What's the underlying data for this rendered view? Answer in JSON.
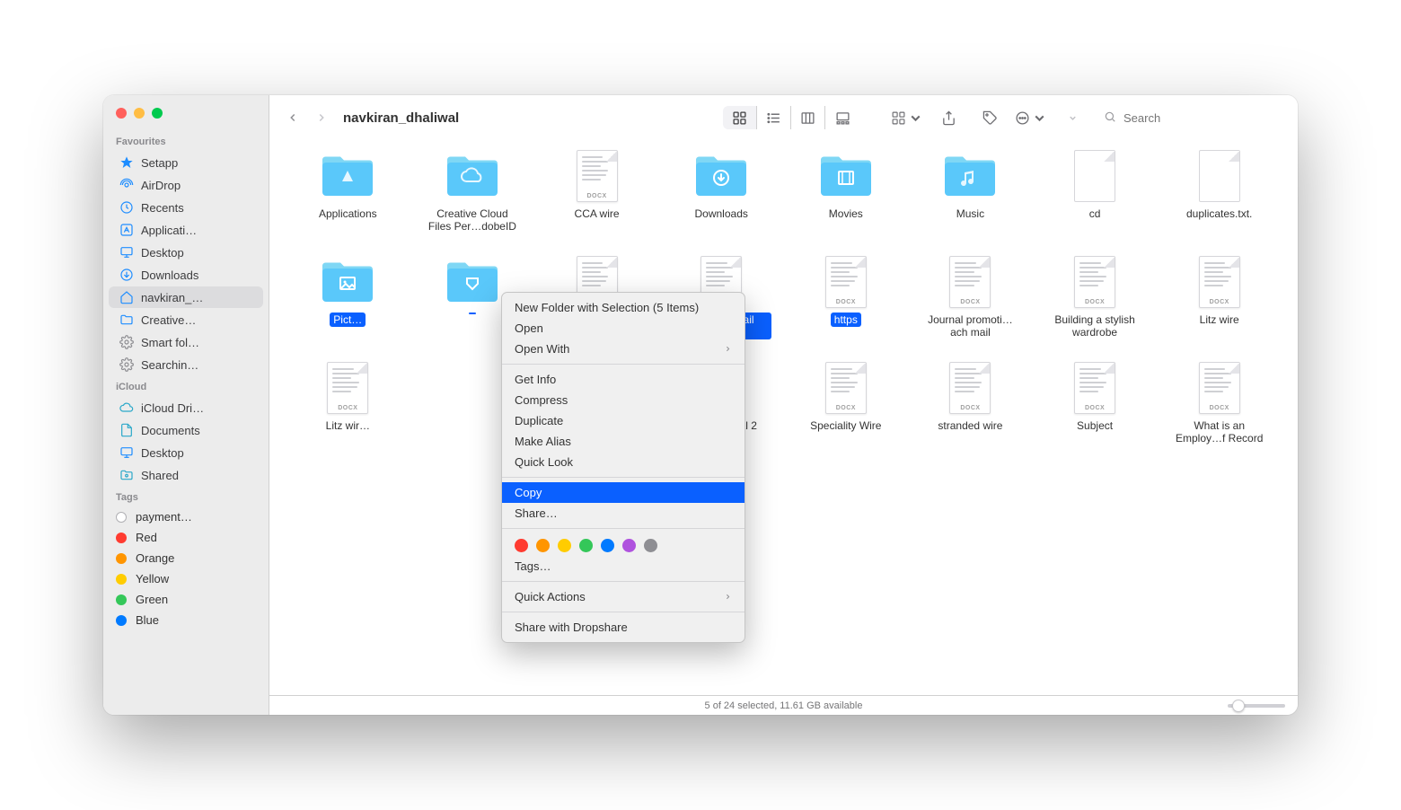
{
  "title": "navkiran_dhaliwal",
  "search": {
    "placeholder": "Search"
  },
  "sidebar": {
    "sections": [
      {
        "label": "Favourites",
        "items": [
          {
            "label": "Setapp",
            "icon": "setapp"
          },
          {
            "label": "AirDrop",
            "icon": "airdrop"
          },
          {
            "label": "Recents",
            "icon": "clock"
          },
          {
            "label": "Applicati…",
            "icon": "applications"
          },
          {
            "label": "Desktop",
            "icon": "desktop"
          },
          {
            "label": "Downloads",
            "icon": "download"
          },
          {
            "label": "navkiran_…",
            "icon": "home",
            "selected": true
          },
          {
            "label": "Creative…",
            "icon": "folder"
          },
          {
            "label": "Smart fol…",
            "icon": "gear"
          },
          {
            "label": "Searchin…",
            "icon": "gear"
          }
        ]
      },
      {
        "label": "iCloud",
        "items": [
          {
            "label": "iCloud Dri…",
            "icon": "cloud"
          },
          {
            "label": "Documents",
            "icon": "doc"
          },
          {
            "label": "Desktop",
            "icon": "desktop"
          },
          {
            "label": "Shared",
            "icon": "shared"
          }
        ]
      },
      {
        "label": "Tags",
        "tags": [
          {
            "label": "payment…",
            "color": "#ffffff",
            "ring": true
          },
          {
            "label": "Red",
            "color": "#ff3b30"
          },
          {
            "label": "Orange",
            "color": "#ff9500"
          },
          {
            "label": "Yellow",
            "color": "#ffcc00"
          },
          {
            "label": "Green",
            "color": "#34c759"
          },
          {
            "label": "Blue",
            "color": "#007aff"
          }
        ]
      }
    ]
  },
  "grid": {
    "items": [
      {
        "label": "Applications",
        "type": "folder",
        "glyph": "apps"
      },
      {
        "label": "Creative Cloud Files Per…dobeID",
        "type": "folder",
        "glyph": "cloud"
      },
      {
        "label": "CCA wire",
        "type": "docx"
      },
      {
        "label": "Downloads",
        "type": "folder",
        "glyph": "download"
      },
      {
        "label": "Movies",
        "type": "folder",
        "glyph": "movie"
      },
      {
        "label": "Music",
        "type": "folder",
        "glyph": "music"
      },
      {
        "label": "cd",
        "type": "txt"
      },
      {
        "label": "duplicates.txt.",
        "type": "txt"
      },
      {
        "label": "Pict…",
        "type": "folder",
        "glyph": "pictures",
        "selected": true
      },
      {
        "label": "",
        "type": "folder",
        "glyph": "public",
        "selected": true
      },
      {
        "label": "",
        "type": "docx",
        "selected": true
      },
      {
        "label": "follow up mail journal",
        "type": "docx",
        "selected": true
      },
      {
        "label": "https",
        "type": "docx",
        "selected": true
      },
      {
        "label": "Journal promoti…ach mail",
        "type": "docx"
      },
      {
        "label": "Building a stylish wardrobe",
        "type": "docx"
      },
      {
        "label": "Litz wire",
        "type": "docx"
      },
      {
        "label": "Litz wir…",
        "type": "docx"
      },
      {
        "label": "",
        "type": "blank"
      },
      {
        "label": "",
        "type": "blank"
      },
      {
        "label": "saran journal 2",
        "type": "docx"
      },
      {
        "label": "Speciality Wire",
        "type": "docx"
      },
      {
        "label": "stranded wire",
        "type": "docx"
      },
      {
        "label": "Subject",
        "type": "docx"
      },
      {
        "label": "What is an Employ…f Record",
        "type": "docx"
      }
    ]
  },
  "contextMenu": {
    "items": [
      {
        "label": "New Folder with Selection (5 Items)"
      },
      {
        "label": "Open"
      },
      {
        "label": "Open With",
        "submenu": true
      },
      {
        "sep": true
      },
      {
        "label": "Get Info"
      },
      {
        "label": "Compress"
      },
      {
        "label": "Duplicate"
      },
      {
        "label": "Make Alias"
      },
      {
        "label": "Quick Look"
      },
      {
        "sep": true
      },
      {
        "label": "Copy",
        "highlighted": true
      },
      {
        "label": "Share…"
      },
      {
        "sep": true
      },
      {
        "tagrow": true
      },
      {
        "label": "Tags…"
      },
      {
        "sep": true
      },
      {
        "label": "Quick Actions",
        "submenu": true
      },
      {
        "sep": true
      },
      {
        "label": "Share with Dropshare"
      }
    ],
    "tagColors": [
      "#ff3b30",
      "#ff9500",
      "#ffcc00",
      "#34c759",
      "#007aff",
      "#af52de",
      "#8e8e93"
    ]
  },
  "statusbar": "5 of 24 selected, 11.61 GB available"
}
